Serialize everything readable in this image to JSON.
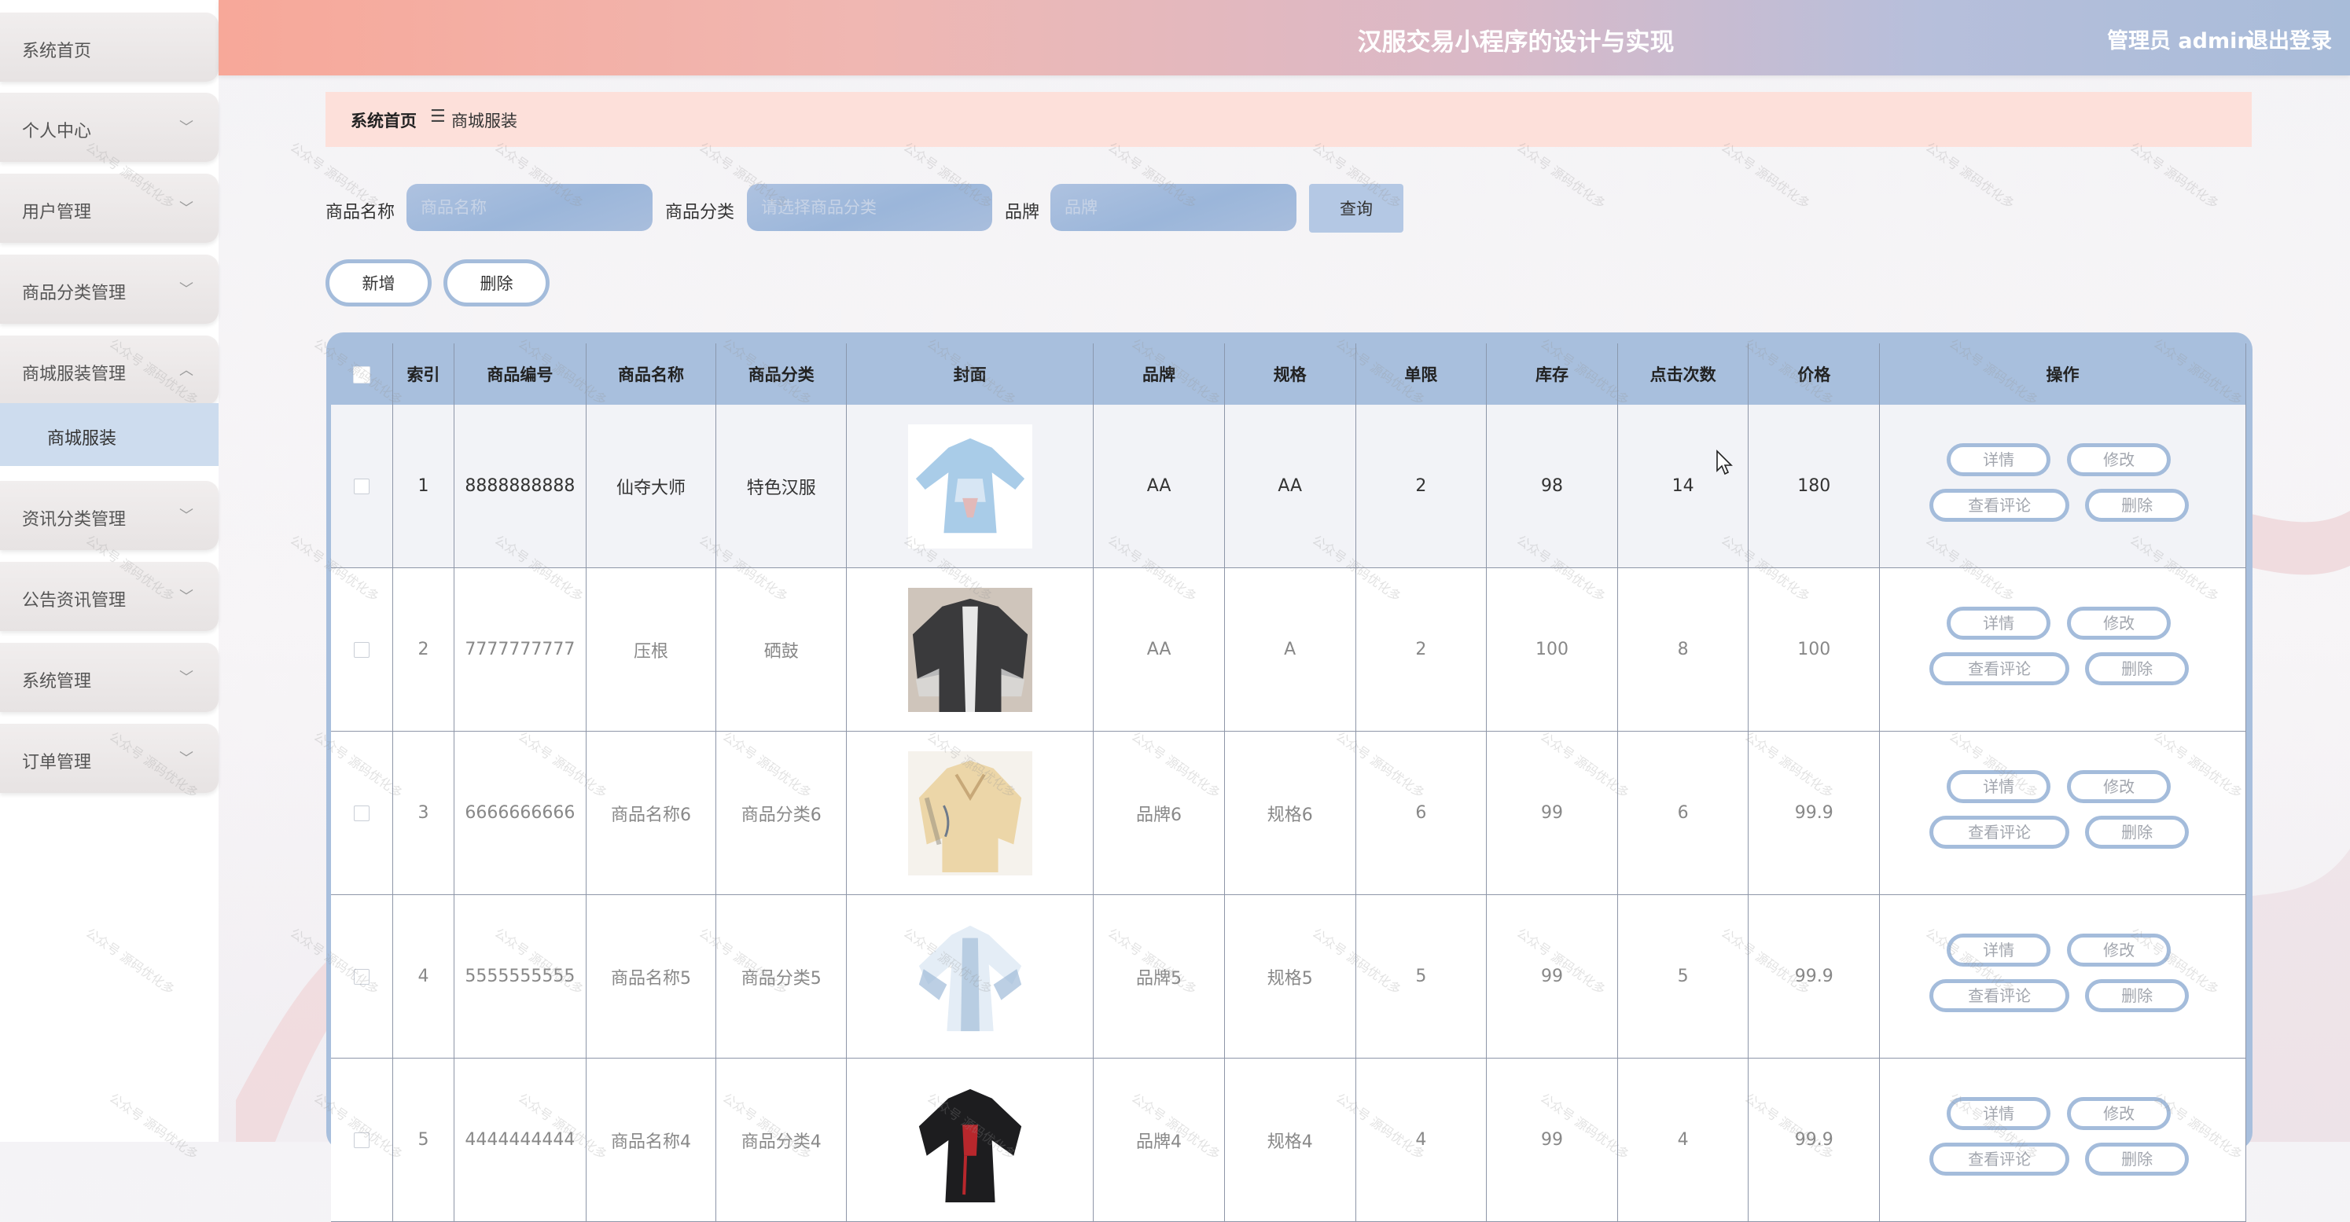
{
  "header": {
    "title": "汉服交易小程序的设计与实现",
    "user_label": "管理员 admin",
    "logout_label": "退出登录"
  },
  "sidebar": {
    "items": [
      {
        "label": "系统首页"
      },
      {
        "label": "个人中心"
      },
      {
        "label": "用户管理"
      },
      {
        "label": "商品分类管理"
      },
      {
        "label": "商城服装管理"
      },
      {
        "label": "资讯分类管理"
      },
      {
        "label": "公告资讯管理"
      },
      {
        "label": "系统管理"
      },
      {
        "label": "订单管理"
      }
    ],
    "active_sub": "商城服装"
  },
  "breadcrumb": {
    "home": "系统首页",
    "separator": "☰",
    "current": "商城服装"
  },
  "search": {
    "name_label": "商品名称",
    "name_placeholder": "商品名称",
    "category_label": "商品分类",
    "category_placeholder": "请选择商品分类",
    "brand_label": "品牌",
    "brand_placeholder": "品牌",
    "query_label": "查询"
  },
  "actions": {
    "add_label": "新增",
    "delete_label": "删除"
  },
  "table": {
    "headers": [
      "索引",
      "商品编号",
      "商品名称",
      "商品分类",
      "封面",
      "品牌",
      "规格",
      "单限",
      "库存",
      "点击次数",
      "价格",
      "操作"
    ],
    "row_ops": {
      "detail": "详情",
      "edit": "修改",
      "comments": "查看评论",
      "delete": "删除"
    },
    "rows": [
      {
        "index": "1",
        "code": "8888888888",
        "name": "仙夺大师",
        "category": "特色汉服",
        "brand": "AA",
        "spec": "AA",
        "limit": "2",
        "stock": "98",
        "clicks": "14",
        "price": "180",
        "cover": "light-blue-hanfu"
      },
      {
        "index": "2",
        "code": "7777777777",
        "name": "压根",
        "category": "硒鼓",
        "brand": "AA",
        "spec": "A",
        "limit": "2",
        "stock": "100",
        "clicks": "8",
        "price": "100",
        "cover": "black-haori"
      },
      {
        "index": "3",
        "code": "6666666666",
        "name": "商品名称6",
        "category": "商品分类6",
        "brand": "品牌6",
        "spec": "规格6",
        "limit": "6",
        "stock": "99",
        "clicks": "6",
        "price": "99.9",
        "cover": "beige-robe"
      },
      {
        "index": "4",
        "code": "5555555555",
        "name": "商品名称5",
        "category": "商品分类5",
        "brand": "品牌5",
        "spec": "规格5",
        "limit": "5",
        "stock": "99",
        "clicks": "5",
        "price": "99.9",
        "cover": "white-blue-hanfu"
      },
      {
        "index": "5",
        "code": "4444444444",
        "name": "商品名称4",
        "category": "商品分类4",
        "brand": "品牌4",
        "spec": "规格4",
        "limit": "4",
        "stock": "99",
        "clicks": "4",
        "price": "99.9",
        "cover": "black-red-hanfu"
      }
    ]
  },
  "watermark": "公众号 源码优化多",
  "colors": {
    "header_start": "#f7a899",
    "header_end": "#a8bcd9",
    "accent_blue": "#a8bfdd",
    "breadcrumb_bg": "#fde0da"
  }
}
